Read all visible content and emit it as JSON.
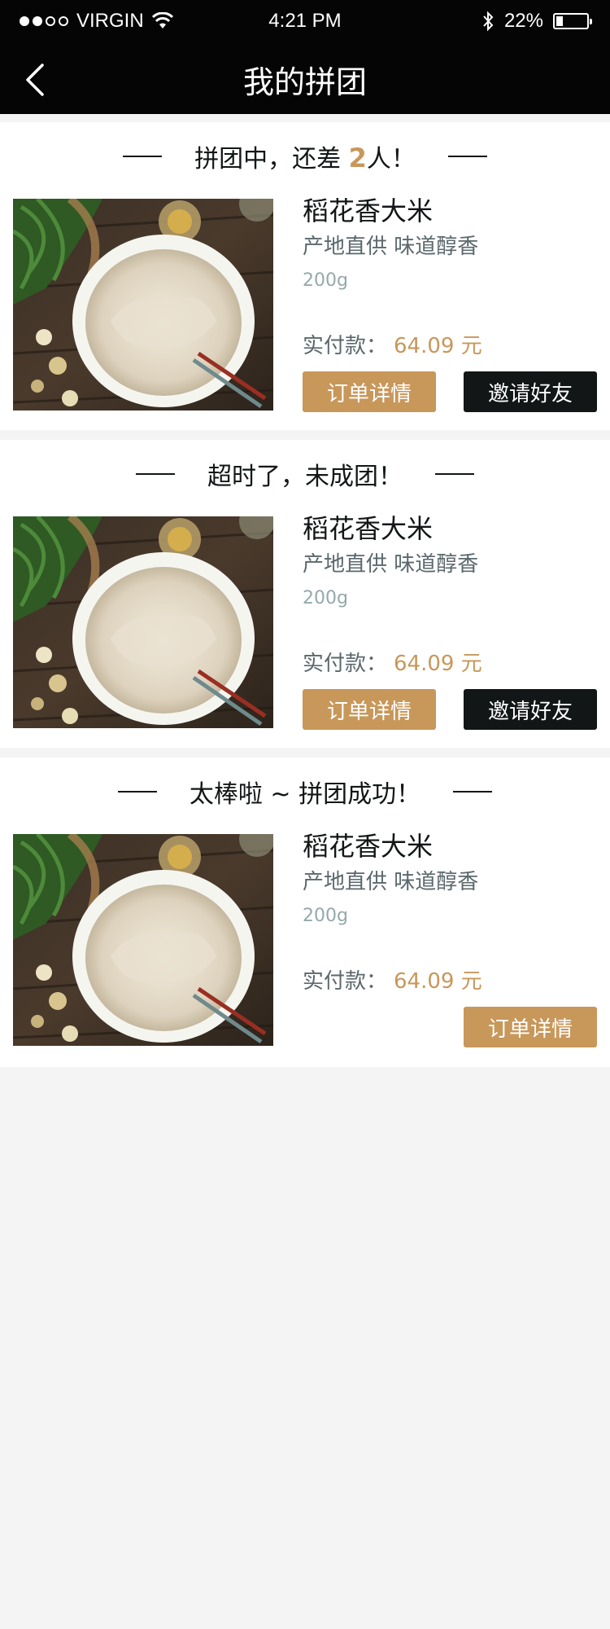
{
  "status": {
    "carrier": "VIRGIN",
    "time": "4:21 PM",
    "battery": "22%",
    "battery_level": 0.22,
    "icons": [
      "signal-dots-icon",
      "wifi-icon",
      "bluetooth-icon",
      "battery-icon"
    ]
  },
  "nav": {
    "title": "我的拼团",
    "back_icon": "chevron-left-icon"
  },
  "colors": {
    "accent": "#c8975a",
    "dark": "#121617",
    "secondary": "#5b686c",
    "muted": "#94a9ac"
  },
  "groups": [
    {
      "header_prefix": "拼团中，还差",
      "header_count": "2",
      "header_suffix": "人！",
      "product_name": "稻花香大米",
      "product_desc": "产地直供 味道醇香",
      "product_weight": "200g",
      "price_label": "实付款：",
      "price_value": "64.09 元",
      "order_button": "订单详情",
      "invite_button": "邀请好友"
    },
    {
      "header": "超时了，未成团！",
      "product_name": "稻花香大米",
      "product_desc": "产地直供 味道醇香",
      "product_weight": "200g",
      "price_label": "实付款：",
      "price_value": "64.09 元",
      "order_button": "订单详情",
      "invite_button": "邀请好友"
    },
    {
      "header": "太棒啦 ~ 拼团成功！",
      "product_name": "稻花香大米",
      "product_desc": "产地直供 味道醇香",
      "product_weight": "200g",
      "price_label": "实付款：",
      "price_value": "64.09 元",
      "order_button": "订单详情"
    }
  ]
}
